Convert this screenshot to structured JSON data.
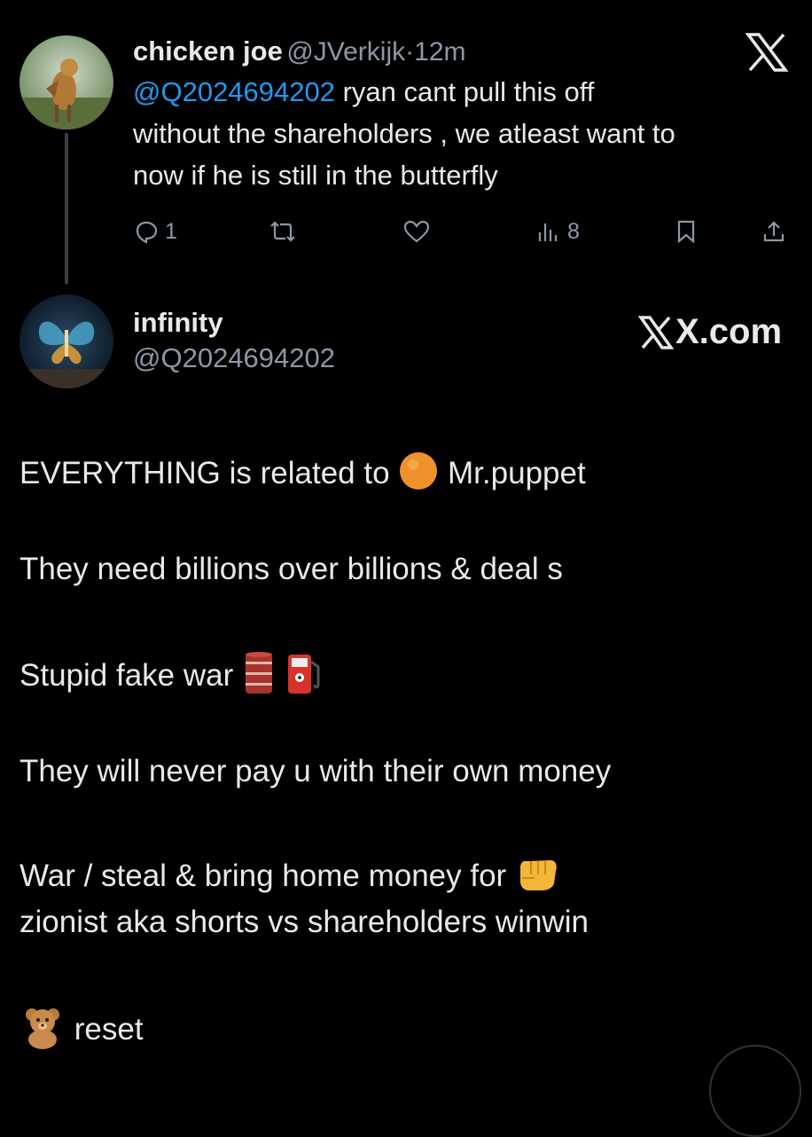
{
  "reply": {
    "author_name": "chicken joe",
    "author_handle": "@JVerkijk",
    "separator": "·",
    "time": "12m",
    "mention": "@Q2024694202",
    "text_line1": " ryan cant pull this off",
    "text_line2": "without the shareholders , we atleast want to",
    "text_line3": "now if he is still in the butterfly",
    "replies_count": "1",
    "views_count": "8"
  },
  "quoted": {
    "author_name": "infinity",
    "author_handle": "@Q2024694202",
    "brand": "X.com"
  },
  "post_lines": {
    "l1_before": "EVERYTHING is related to",
    "l1_after": "Mr.puppet",
    "l2": "They need billions over billions & deal s",
    "l3": "Stupid fake war",
    "l4": "They will never pay u with their own money",
    "l5": "War / steal & bring home money for",
    "l6": "zionist aka shorts vs shareholders winwin",
    "l7": "reset"
  },
  "icons": {
    "x_logo": "x-logo-icon",
    "reply": "comment-icon",
    "repost": "repost-icon",
    "like": "heart-icon",
    "views": "views-icon",
    "bookmark": "bookmark-icon",
    "share": "share-icon"
  },
  "colors": {
    "background": "#000000",
    "text": "#e7e9ea",
    "muted": "#8b98a5",
    "mention": "#1d9bf0"
  }
}
